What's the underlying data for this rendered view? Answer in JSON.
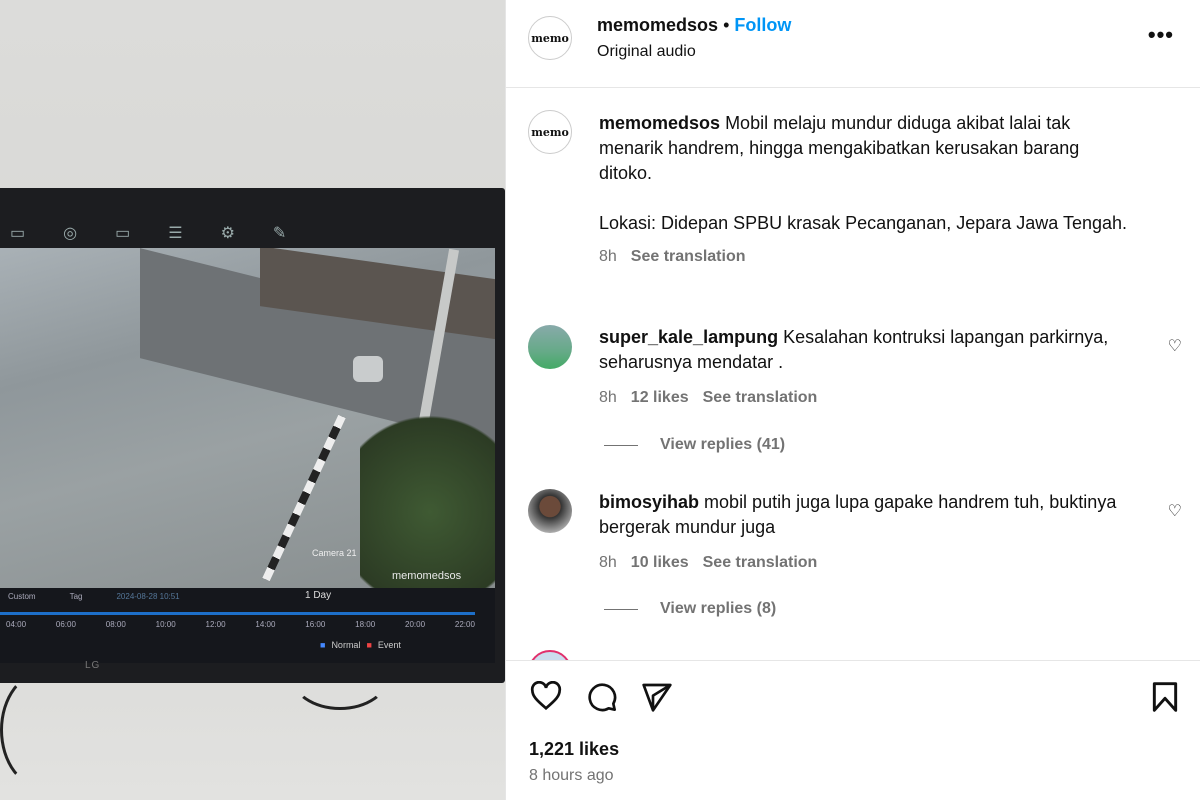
{
  "media": {
    "toolbar_icons": [
      "folder-icon",
      "search-icon",
      "camera-icon",
      "database-icon",
      "gear-icon",
      "wrench-icon"
    ],
    "watermark": "memomedsos",
    "camera_label": "Camera 21",
    "playback": {
      "custom": "Custom",
      "tag": "Tag",
      "date": "2024-08-28 10:51",
      "range": "1 Day",
      "times": [
        "04:00",
        "06:00",
        "08:00",
        "10:00",
        "12:00",
        "14:00",
        "16:00",
        "18:00",
        "20:00",
        "22:00"
      ],
      "legend_normal": "Normal",
      "legend_event": "Event"
    },
    "tv_brand": "LG"
  },
  "header": {
    "username": "memomedsos",
    "separator": "•",
    "follow": "Follow",
    "subtitle": "Original audio",
    "avatar_text": "memo"
  },
  "caption": {
    "username": "memomedsos",
    "text": "Mobil melaju mundur diduga akibat lalai tak menarik handrem, hingga mengakibatkan kerusakan barang ditoko.",
    "location": "Lokasi: Didepan SPBU krasak Pecanganan, Jepara Jawa Tengah.",
    "time": "8h",
    "translate": "See translation"
  },
  "comments": [
    {
      "username": "super_kale_lampung",
      "text": "Kesalahan kontruksi lapangan parkirnya, seharusnya mendatar .",
      "time": "8h",
      "likes": "12 likes",
      "translate": "See translation",
      "replies": "View replies (41)"
    },
    {
      "username": "bimosyihab",
      "text": "mobil putih juga lupa gapake handrem tuh, buktinya bergerak mundur juga",
      "time": "8h",
      "likes": "10 likes",
      "translate": "See translation",
      "replies": "View replies (8)"
    }
  ],
  "footer": {
    "likes": "1,221 likes",
    "time": "8 hours ago"
  },
  "colors": {
    "accent": "#0095f6",
    "muted": "#737373"
  }
}
